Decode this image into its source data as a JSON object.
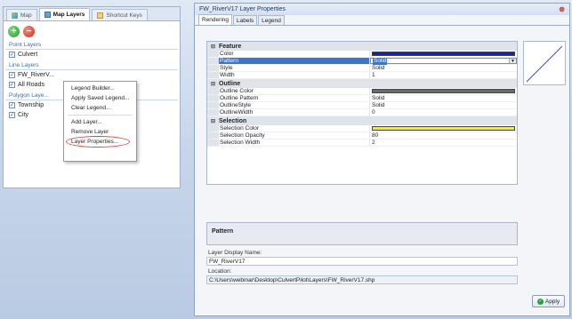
{
  "left_panel": {
    "tabs": [
      {
        "label": "Map",
        "icon": "map-icon"
      },
      {
        "label": "Map Layers",
        "icon": "layers-icon",
        "active": true
      },
      {
        "label": "Shortcut Keys",
        "icon": "keys-icon"
      }
    ],
    "add_icon": "+",
    "remove_icon": "−",
    "groups": [
      {
        "header": "Point Layers",
        "layers": [
          {
            "name": "Culvert",
            "checked": true
          }
        ]
      },
      {
        "header": "Line Layers",
        "layers": [
          {
            "name": "FW_RiverV...",
            "checked": true
          },
          {
            "name": "All Roads",
            "checked": true
          }
        ]
      },
      {
        "header": "Polygon Laye...",
        "layers": [
          {
            "name": "Township",
            "checked": true
          },
          {
            "name": "City",
            "checked": true
          }
        ]
      }
    ],
    "context_menu": {
      "items": [
        "Legend Builder...",
        "Apply Saved Legend...",
        "Clear Legend...",
        "Add Layer...",
        "Remove Layer",
        "Layer Properties..."
      ]
    }
  },
  "window": {
    "title": "FW_RiverV17 Layer Properties",
    "close_glyph": "⊗",
    "tabs": [
      "Rendering",
      "Labels",
      "Legend"
    ],
    "sections": [
      {
        "title": "Feature",
        "rows": [
          {
            "name": "Color",
            "value": "",
            "swatch": "#0a1fcf"
          },
          {
            "name": "Pattern",
            "value": "Solid",
            "selected": true,
            "dropdown": true
          },
          {
            "name": "Style",
            "value": "Solid"
          },
          {
            "name": "Width",
            "value": "1"
          }
        ]
      },
      {
        "title": "Outline",
        "rows": [
          {
            "name": "Outline Color",
            "value": "",
            "swatch": "#6b6b6b"
          },
          {
            "name": "Outline Pattern",
            "value": "Solid"
          },
          {
            "name": "OutlineStyle",
            "value": "Solid"
          },
          {
            "name": "OutlineWidth",
            "value": "0"
          }
        ]
      },
      {
        "title": "Selection",
        "rows": [
          {
            "name": "Selection Color",
            "value": "",
            "swatch": "#f4ef2a"
          },
          {
            "name": "Selection Opacity",
            "value": "80"
          },
          {
            "name": "Selection Width",
            "value": "2"
          }
        ]
      }
    ],
    "description_title": "Pattern",
    "display_name_label": "Layer Display Name:",
    "display_name_value": "FW_RiverV17",
    "location_label": "Location:",
    "location_value": "C:\\Users\\webinar\\Desktop\\CulvertPilot\\Layers\\FW_RiverV17.shp",
    "apply_label": "Apply"
  }
}
